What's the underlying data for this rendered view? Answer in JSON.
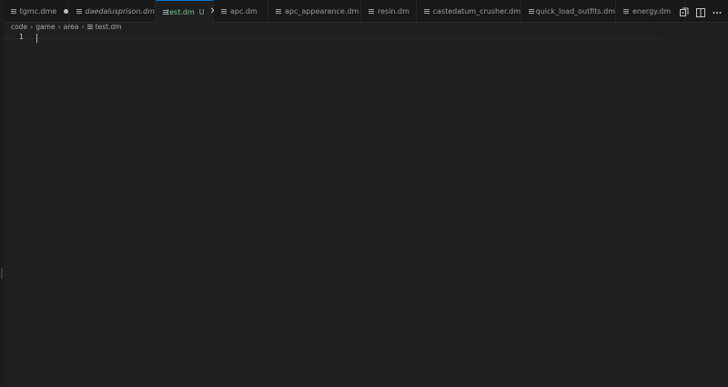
{
  "tabs": [
    {
      "label": "tgmc.dme",
      "state": "dirty"
    },
    {
      "label": "daedalusprison.dm",
      "state": "preview"
    },
    {
      "label": "test.dm",
      "state": "active",
      "git_status": "U",
      "close": "✕"
    },
    {
      "label": "apc.dm"
    },
    {
      "label": "apc_appearance.dm"
    },
    {
      "label": "resin.dm"
    },
    {
      "label": "castedatum_crusher.dm"
    },
    {
      "label": "quick_load_outfits.dm"
    },
    {
      "label": "energy.dm"
    }
  ],
  "tab_actions": [
    "compare-changes-icon",
    "split-editor-icon",
    "more-actions-icon"
  ],
  "breadcrumb": [
    "code",
    "game",
    "area",
    "test.dm"
  ],
  "editor": {
    "line_numbers": [
      "1"
    ],
    "content": ""
  },
  "colors": {
    "editor_bg": "#1f1f1f",
    "tabbar_bg": "#181818",
    "active_tab_border": "#0078d4",
    "untracked_green": "#73c991"
  }
}
